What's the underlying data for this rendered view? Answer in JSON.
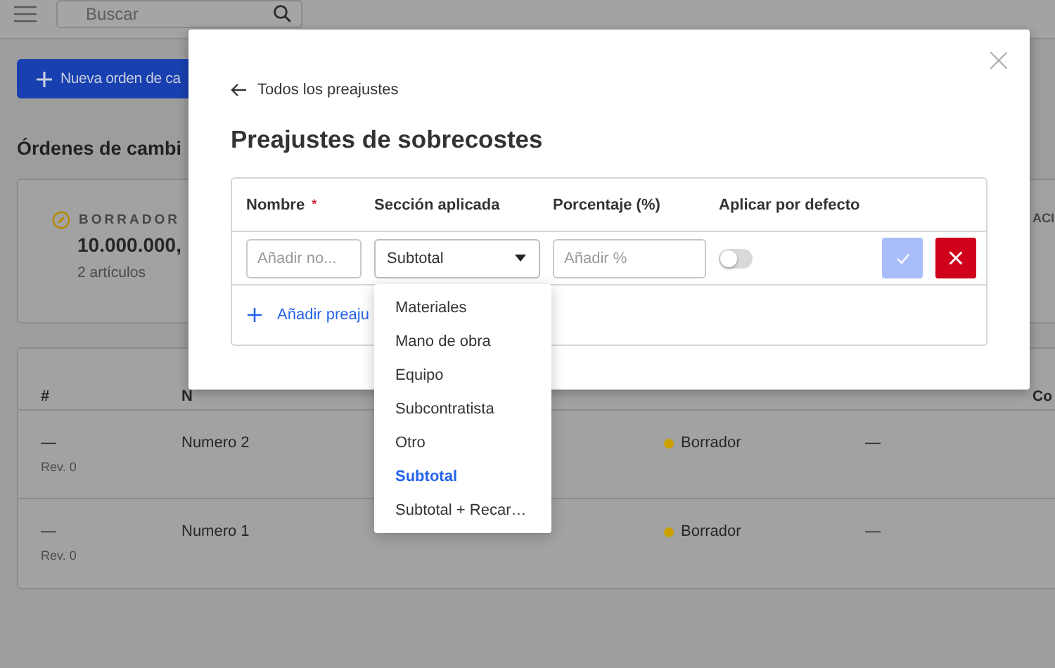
{
  "top_bar": {
    "search": {
      "placeholder": "Buscar"
    }
  },
  "new_button": "Nueva orden de ca",
  "heading": "Órdenes de cambi",
  "summary_cards": [
    {
      "label": "BORRADOR",
      "amount": "10.000.000,",
      "count": "2 artículos"
    },
    {
      "label": "ACI"
    }
  ],
  "orders_table": {
    "columns": [
      "#",
      "N",
      "Co"
    ],
    "rows": [
      {
        "number": "—",
        "revision": "Rev. 0",
        "name": "Numero 2",
        "status": "Borrador",
        "color": "#c9a000",
        "column_4": "—"
      },
      {
        "number": "—",
        "revision": "Rev. 0",
        "name": "Numero 1",
        "status": "Borrador",
        "color": "#c9a000",
        "column_4": "—"
      }
    ]
  },
  "modal": {
    "back_link": "Todos los preajustes",
    "title": "Preajustes de sobrecostes",
    "columns": [
      {
        "label": "Nombre",
        "required_mark": "*"
      },
      {
        "label": "Sección aplicada"
      },
      {
        "label": "Porcentaje (%)"
      },
      {
        "label": "Aplicar por defecto"
      }
    ],
    "new_row": {
      "name_placeholder": "Añadir no...",
      "section": "Subtotal",
      "percent_placeholder": "Añadir %",
      "default_on": false,
      "confirm_disabled": true
    },
    "add_link": "Añadir preaju",
    "section_dropdown": {
      "expanded": true,
      "options": [
        {
          "label": "Materiales",
          "selected": false
        },
        {
          "label": "Mano de obra",
          "selected": false
        },
        {
          "label": "Equipo",
          "selected": false
        },
        {
          "label": "Subcontratista",
          "selected": false
        },
        {
          "label": "Otro",
          "selected": false
        },
        {
          "label": "Subtotal",
          "selected": true
        },
        {
          "label": "Subtotal + Recar…",
          "selected": false
        }
      ]
    }
  }
}
